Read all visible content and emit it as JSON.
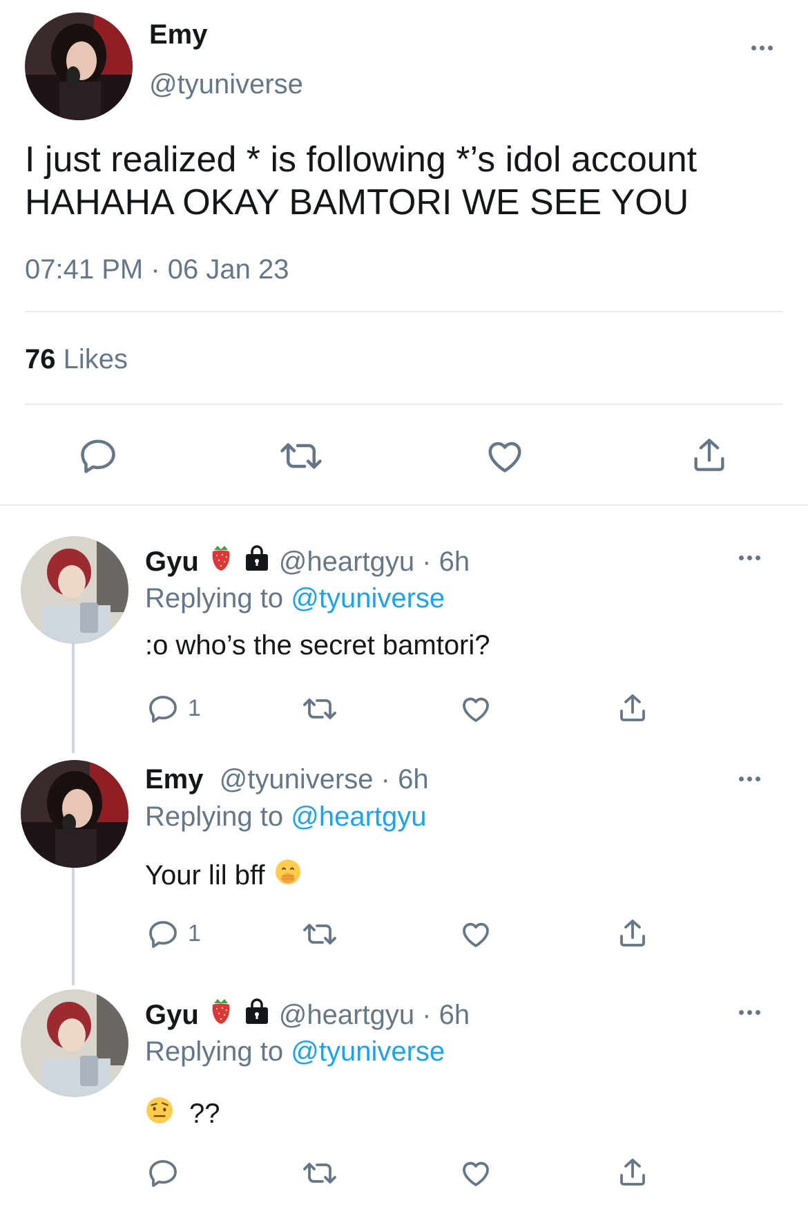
{
  "main_tweet": {
    "author_name": "Emy",
    "handle": "@tyuniverse",
    "text_line1": "I just realized * is following *’s idol account",
    "text_line2": "HAHAHA OKAY BAMTORI WE SEE YOU",
    "time": "07:41 PM",
    "separator": "·",
    "date": "06 Jan 23",
    "likes_count": "76",
    "likes_label": "Likes"
  },
  "replies": [
    {
      "author_name": "Gyu",
      "handle_time": "@heartgyu · 6h",
      "replying_prefix": "Replying to",
      "replying_to": "@tyuniverse",
      "text": ":o who’s the secret bamtori?",
      "reply_count": "1",
      "badge_icons": [
        "strawberry-icon",
        "lock-icon"
      ]
    },
    {
      "author_name": "Emy",
      "handle_time": "@tyuniverse · 6h",
      "replying_prefix": "Replying to",
      "replying_to": "@heartgyu",
      "text": "Your lil bff",
      "reply_count": "1",
      "emoji": "hand-over-mouth-emoji"
    },
    {
      "author_name": "Gyu",
      "handle_time": "@heartgyu · 6h",
      "replying_prefix": "Replying to",
      "replying_to": "@tyuniverse",
      "text": "??",
      "reply_count": "",
      "emoji": "raised-eyebrow-emoji",
      "badge_icons": [
        "strawberry-icon",
        "lock-icon"
      ]
    }
  ],
  "colors": {
    "text": "#14171a",
    "secondary": "#657786",
    "link": "#1da1f2",
    "divider": "#e6ecf0"
  }
}
